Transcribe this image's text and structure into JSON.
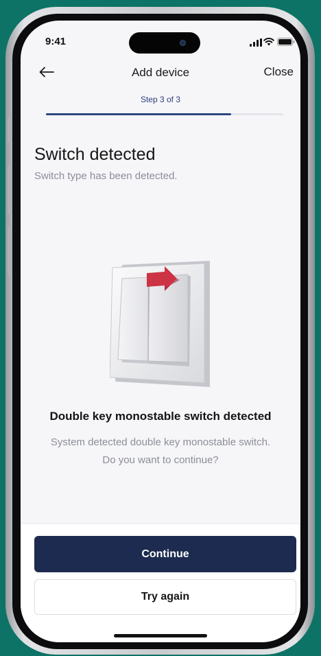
{
  "status_bar": {
    "time": "9:41"
  },
  "nav": {
    "title": "Add device",
    "close_label": "Close"
  },
  "progress": {
    "step_label": "Step 3 of 3",
    "fraction": 0.78
  },
  "heading": {
    "title": "Switch detected",
    "subtitle": "Switch type has been detected."
  },
  "detection": {
    "title": "Double key monostable switch detected",
    "description": "System detected double key monostable switch. Do you want to continue?"
  },
  "actions": {
    "continue_label": "Continue",
    "try_again_label": "Try again"
  },
  "colors": {
    "background": "#0d7366",
    "primary": "#1c2b4f",
    "progress": "#2c4780",
    "arrow": "#cc3344"
  },
  "icons": [
    "back-arrow-icon",
    "signal-icon",
    "wifi-icon",
    "battery-icon",
    "switch-illustration",
    "arrow-icon"
  ]
}
